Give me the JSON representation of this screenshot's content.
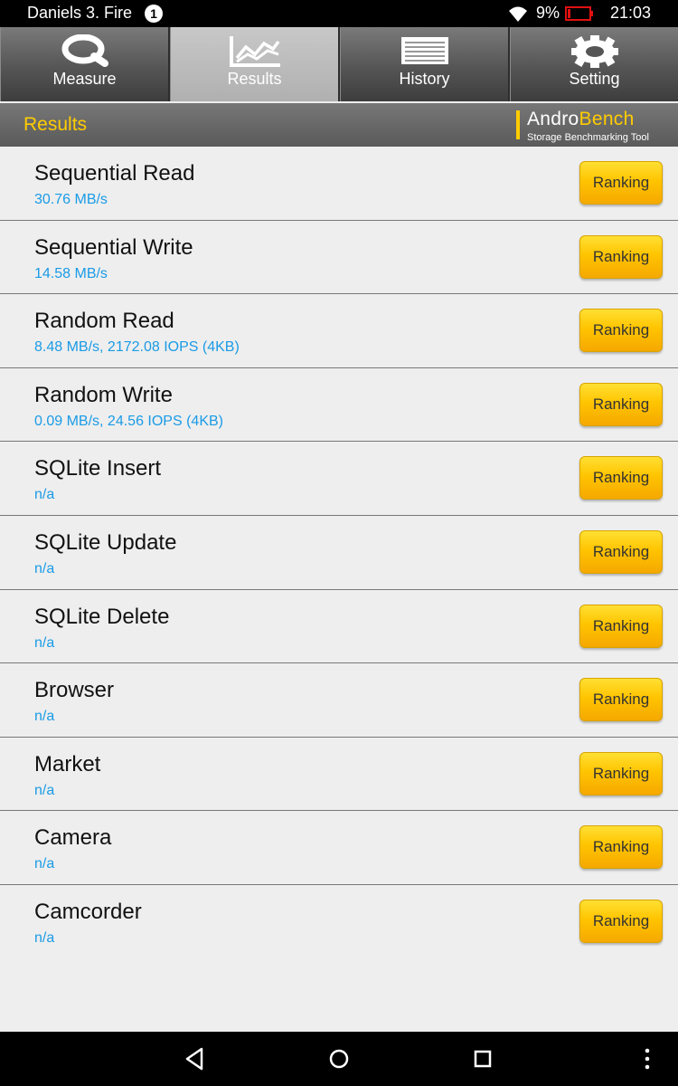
{
  "status_bar": {
    "device_name": "Daniels 3. Fire",
    "notification_count": "1",
    "battery_level": "9%",
    "time": "21:03"
  },
  "tabs": [
    {
      "label": "Measure",
      "icon": "magnifier-icon",
      "active": false
    },
    {
      "label": "Results",
      "icon": "chart-icon",
      "active": true
    },
    {
      "label": "History",
      "icon": "list-icon",
      "active": false
    },
    {
      "label": "Setting",
      "icon": "gear-icon",
      "active": false
    }
  ],
  "header": {
    "title": "Results",
    "logo_part1": "Andro",
    "logo_part2": "Bench",
    "logo_tagline": "Storage Benchmarking Tool"
  },
  "results": [
    {
      "name": "Sequential Read",
      "value": "30.76 MB/s",
      "button": "Ranking"
    },
    {
      "name": "Sequential Write",
      "value": "14.58 MB/s",
      "button": "Ranking"
    },
    {
      "name": "Random Read",
      "value": "8.48 MB/s, 2172.08 IOPS (4KB)",
      "button": "Ranking"
    },
    {
      "name": "Random Write",
      "value": "0.09 MB/s, 24.56 IOPS (4KB)",
      "button": "Ranking"
    },
    {
      "name": "SQLite Insert",
      "value": "n/a",
      "button": "Ranking"
    },
    {
      "name": "SQLite Update",
      "value": "n/a",
      "button": "Ranking"
    },
    {
      "name": "SQLite Delete",
      "value": "n/a",
      "button": "Ranking"
    },
    {
      "name": "Browser",
      "value": "n/a",
      "button": "Ranking"
    },
    {
      "name": "Market",
      "value": "n/a",
      "button": "Ranking"
    },
    {
      "name": "Camera",
      "value": "n/a",
      "button": "Ranking"
    },
    {
      "name": "Camcorder",
      "value": "n/a",
      "button": "Ranking"
    }
  ],
  "nav_bar": {
    "buttons": [
      "back-icon",
      "home-icon",
      "recents-icon",
      "more-icon"
    ]
  },
  "colors": {
    "accent": "#ffcc00",
    "value_text": "#1a9be6",
    "battery_low": "#e01010"
  }
}
